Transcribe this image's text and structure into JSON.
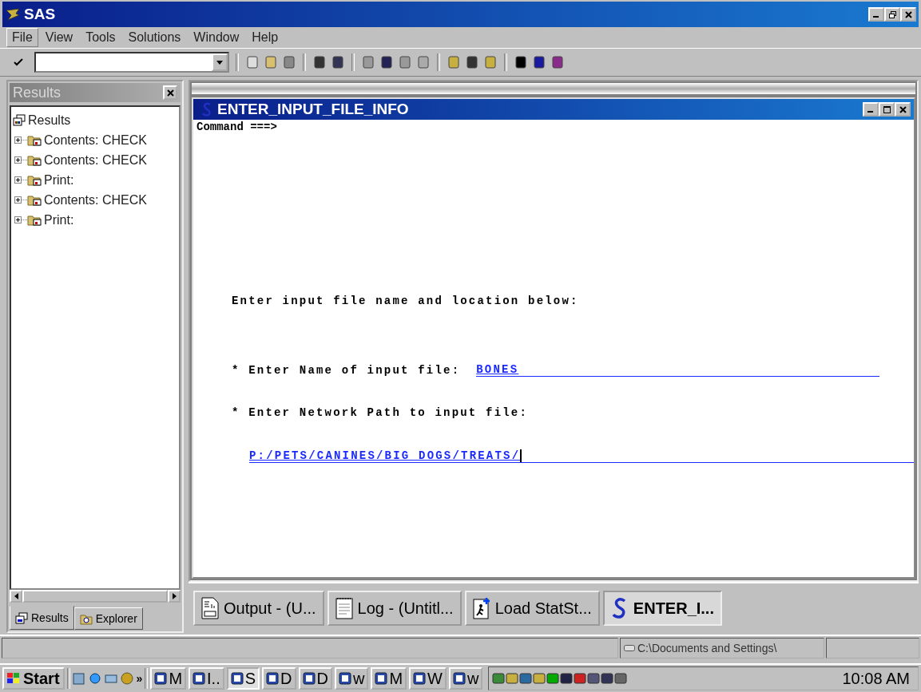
{
  "app": {
    "title": "SAS"
  },
  "menu": [
    {
      "label": "File",
      "selected": true
    },
    {
      "label": "View",
      "selected": false
    },
    {
      "label": "Tools",
      "selected": false
    },
    {
      "label": "Solutions",
      "selected": false
    },
    {
      "label": "Window",
      "selected": false
    },
    {
      "label": "Help",
      "selected": false
    }
  ],
  "results_panel": {
    "title": "Results",
    "tree": {
      "label": "Results",
      "children": [
        {
          "label": "Contents:  CHECK",
          "expanded": false
        },
        {
          "label": "Contents:  CHECK",
          "expanded": false
        },
        {
          "label": "Print:",
          "expanded": false
        },
        {
          "label": "Contents:  CHECK",
          "expanded": false
        },
        {
          "label": "Print:",
          "expanded": false
        }
      ]
    },
    "tabs": [
      {
        "label": "Results",
        "selected": true
      },
      {
        "label": "Explorer",
        "selected": false
      }
    ]
  },
  "editor": {
    "title": "ENTER_INPUT_FILE_INFO",
    "command": "Command ===>",
    "heading": "Enter input file name and location below:",
    "name_field": {
      "label": "* Enter Name of input file:",
      "value": "BONES"
    },
    "path_field": {
      "label": "* Enter Network Path to input file:",
      "value": "P:/PETS/CANINES/BIG DOGS/TREATS/"
    }
  },
  "window_bar": [
    {
      "label": "Output - (U...",
      "kind": "output",
      "selected": false
    },
    {
      "label": "Log - (Untitl...",
      "kind": "log",
      "selected": false
    },
    {
      "label": "Load StatSt...",
      "kind": "program",
      "selected": false
    },
    {
      "label": "ENTER_I...",
      "kind": "sas",
      "selected": true
    }
  ],
  "status_bar": {
    "path": "C:\\Documents and Settings\\"
  },
  "taskbar": {
    "start": "Start",
    "more": "»",
    "tasks": [
      {
        "label": "M",
        "selected": false
      },
      {
        "label": "I..",
        "selected": false
      },
      {
        "label": "S",
        "selected": true
      },
      {
        "label": "D",
        "selected": false
      },
      {
        "label": "D",
        "selected": false
      },
      {
        "label": "w",
        "selected": false
      },
      {
        "label": "M",
        "selected": false
      },
      {
        "label": "W",
        "selected": false
      },
      {
        "label": "w",
        "selected": false
      }
    ],
    "clock": "10:08 AM"
  }
}
